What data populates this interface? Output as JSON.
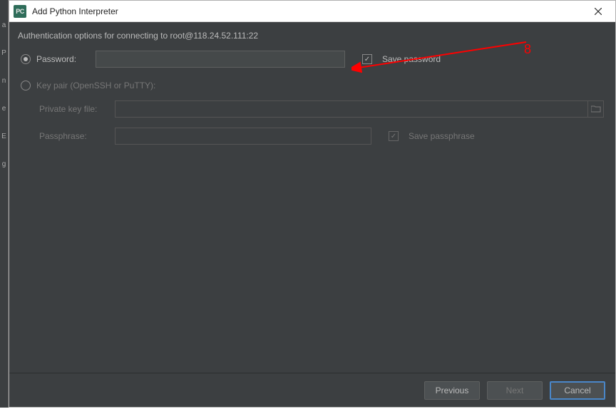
{
  "titlebar": {
    "app_icon_text": "PC",
    "title": "Add Python Interpreter"
  },
  "content": {
    "auth_header": "Authentication options for connecting to root@118.24.52.111:22",
    "password_opt": {
      "label": "Password:",
      "save_label": "Save password"
    },
    "keypair_opt": {
      "label": "Key pair (OpenSSH or PuTTY):",
      "private_key_label": "Private key file:",
      "passphrase_label": "Passphrase:",
      "save_passphrase_label": "Save passphrase"
    }
  },
  "footer": {
    "previous": "Previous",
    "next": "Next",
    "cancel": "Cancel"
  },
  "annotation": {
    "number": "8"
  }
}
